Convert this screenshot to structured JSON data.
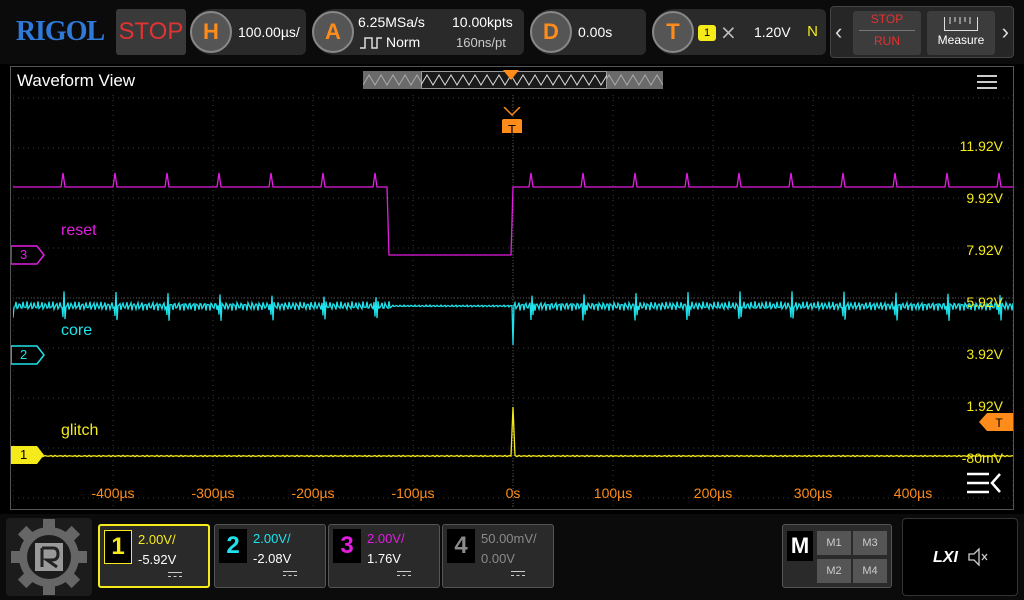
{
  "header": {
    "logo": "RIGOL",
    "run_state": "STOP",
    "horizontal": {
      "icon": "H",
      "timebase": "100.00µs/"
    },
    "acquire": {
      "icon": "A",
      "sample_rate": "6.25MSa/s",
      "mode": "Norm",
      "memory_depth": "10.00kpts",
      "sample_interval": "160ns/pt"
    },
    "delay": {
      "icon": "D",
      "value": "0.00s"
    },
    "trigger": {
      "icon": "T",
      "channel": "1",
      "level": "1.20V",
      "sweep": "N"
    },
    "run_stop_button": {
      "line1": "STOP",
      "line2": "RUN"
    },
    "measure_button": "Measure"
  },
  "waveform_view": {
    "title": "Waveform View",
    "traces": [
      {
        "name": "reset",
        "channel": "3",
        "color": "#e21ee2"
      },
      {
        "name": "core",
        "channel": "2",
        "color": "#1ee3ec"
      },
      {
        "name": "glitch",
        "channel": "1",
        "color": "#f5ea1a"
      }
    ],
    "voltage_labels": [
      "11.92V",
      "9.92V",
      "7.92V",
      "5.92V",
      "3.92V",
      "1.92V",
      "-80mV"
    ],
    "time_labels": [
      "-400µs",
      "-300µs",
      "-200µs",
      "-100µs",
      "0s",
      "100µs",
      "200µs",
      "300µs",
      "400µs"
    ],
    "trigger_marker": "T"
  },
  "channels": [
    {
      "num": "1",
      "scale": "2.00V/",
      "offset": "-5.92V",
      "color": "#f5ea1a",
      "active": true
    },
    {
      "num": "2",
      "scale": "2.00V/",
      "offset": "-2.08V",
      "color": "#1ee3ec",
      "active": false
    },
    {
      "num": "3",
      "scale": "2.00V/",
      "offset": "1.76V",
      "color": "#e21ee2",
      "active": false
    },
    {
      "num": "4",
      "scale": "50.00mV/",
      "offset": "0.00V",
      "color": "#7a7a7a",
      "active": false
    }
  ],
  "math": {
    "label": "M",
    "buttons": [
      "M1",
      "M3",
      "M2",
      "M4"
    ]
  },
  "status": {
    "lxi": "LXI"
  }
}
